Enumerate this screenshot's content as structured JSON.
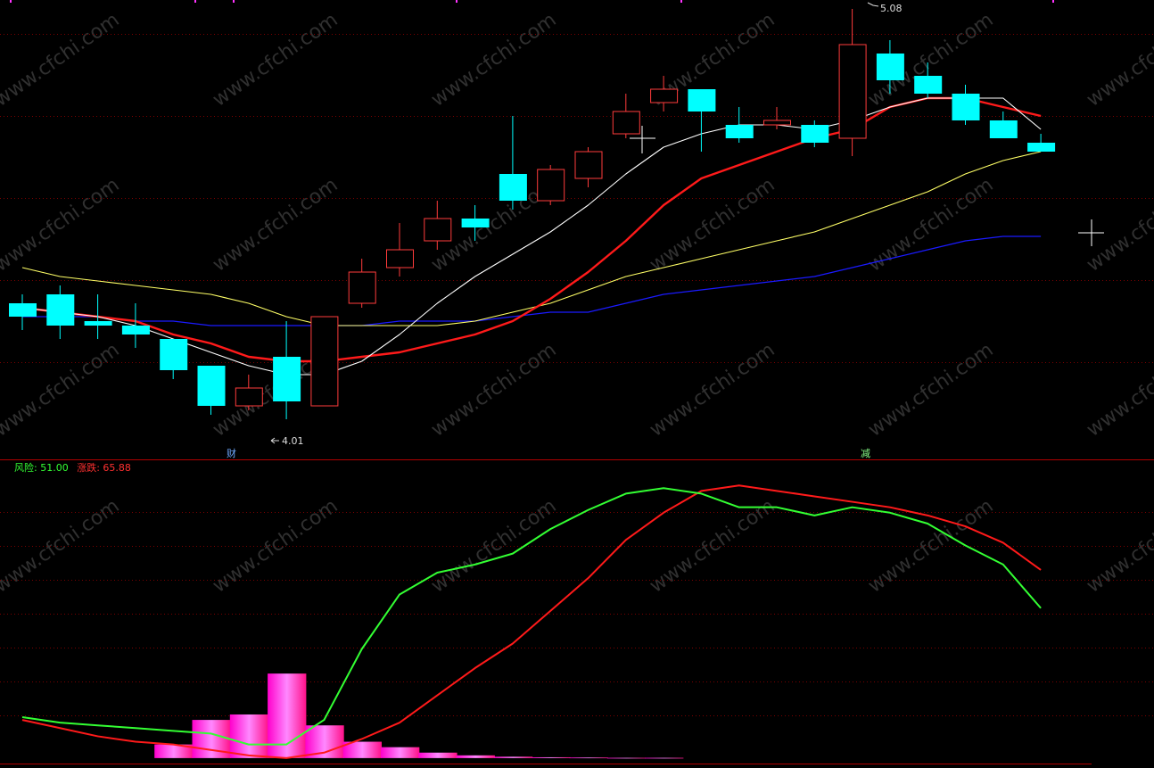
{
  "watermark": "www.cfchi.com",
  "price_panel": {
    "high_label": "5.08",
    "low_label": "4.01",
    "marker_cai": "财",
    "marker_jian": "减"
  },
  "indicator_panel": {
    "risk_label": "风险",
    "risk_value": "51.00",
    "change_label": "涨跌",
    "change_value": "65.88"
  },
  "colors": {
    "background": "#000000",
    "up": "#ff3b3b",
    "down": "#00ffff",
    "ma_white": "#ffffff",
    "ma_red": "#ff1a1a",
    "ma_yellow": "#ffff66",
    "ma_blue": "#1a1aff",
    "risk_line": "#33ff33",
    "change_line": "#ff1a1a",
    "histogram": "#ff33ff",
    "grid": "#7a0000"
  },
  "chart_data": [
    {
      "type": "candlestick",
      "candles": [
        {
          "o": 4.58,
          "c": 4.55,
          "h": 4.6,
          "l": 4.52
        },
        {
          "o": 4.6,
          "c": 4.53,
          "h": 4.62,
          "l": 4.5
        },
        {
          "o": 4.54,
          "c": 4.53,
          "h": 4.6,
          "l": 4.5
        },
        {
          "o": 4.53,
          "c": 4.51,
          "h": 4.58,
          "l": 4.48
        },
        {
          "o": 4.5,
          "c": 4.43,
          "h": 4.5,
          "l": 4.41
        },
        {
          "o": 4.44,
          "c": 4.35,
          "h": 4.44,
          "l": 4.33
        },
        {
          "o": 4.35,
          "c": 4.39,
          "h": 4.42,
          "l": 4.34
        },
        {
          "o": 4.46,
          "c": 4.36,
          "h": 4.54,
          "l": 4.32
        },
        {
          "o": 4.35,
          "c": 4.55,
          "h": 4.55,
          "l": 4.35
        },
        {
          "o": 4.58,
          "c": 4.65,
          "h": 4.68,
          "l": 4.57
        },
        {
          "o": 4.66,
          "c": 4.7,
          "h": 4.76,
          "l": 4.64
        },
        {
          "o": 4.72,
          "c": 4.77,
          "h": 4.81,
          "l": 4.7
        },
        {
          "o": 4.77,
          "c": 4.75,
          "h": 4.8,
          "l": 4.72
        },
        {
          "o": 4.87,
          "c": 4.81,
          "h": 5.0,
          "l": 4.79
        },
        {
          "o": 4.81,
          "c": 4.88,
          "h": 4.89,
          "l": 4.8
        },
        {
          "o": 4.86,
          "c": 4.92,
          "h": 4.93,
          "l": 4.84
        },
        {
          "o": 4.96,
          "c": 5.01,
          "h": 5.05,
          "l": 4.95
        },
        {
          "o": 5.03,
          "c": 5.06,
          "h": 5.09,
          "l": 5.01
        },
        {
          "o": 5.06,
          "c": 5.01,
          "h": 5.06,
          "l": 4.92
        },
        {
          "o": 4.98,
          "c": 4.95,
          "h": 5.02,
          "l": 4.94
        },
        {
          "o": 4.98,
          "c": 4.99,
          "h": 5.02,
          "l": 4.97
        },
        {
          "o": 4.98,
          "c": 4.94,
          "h": 4.99,
          "l": 4.93
        },
        {
          "o": 4.95,
          "c": 5.16,
          "h": 5.24,
          "l": 4.91
        },
        {
          "o": 5.14,
          "c": 5.08,
          "h": 5.17,
          "l": 5.05
        },
        {
          "o": 5.09,
          "c": 5.05,
          "h": 5.12,
          "l": 5.04
        },
        {
          "o": 5.05,
          "c": 4.99,
          "h": 5.07,
          "l": 4.98
        },
        {
          "o": 4.99,
          "c": 4.95,
          "h": 5.01,
          "l": 4.95
        },
        {
          "o": 4.94,
          "c": 4.92,
          "h": 4.96,
          "l": 4.92
        }
      ],
      "ma_white": [
        4.57,
        4.56,
        4.55,
        4.53,
        4.5,
        4.47,
        4.44,
        4.42,
        4.42,
        4.45,
        4.51,
        4.58,
        4.64,
        4.69,
        4.74,
        4.8,
        4.87,
        4.93,
        4.96,
        4.98,
        4.98,
        4.97,
        4.99,
        5.02,
        5.04,
        5.04,
        5.04,
        4.97
      ],
      "ma_red": [
        4.57,
        4.56,
        4.55,
        4.54,
        4.51,
        4.49,
        4.46,
        4.45,
        4.45,
        4.46,
        4.47,
        4.49,
        4.51,
        4.54,
        4.59,
        4.65,
        4.72,
        4.8,
        4.86,
        4.89,
        4.92,
        4.95,
        4.97,
        5.02,
        5.04,
        5.04,
        5.02,
        5.0
      ],
      "ma_yellow": [
        4.66,
        4.64,
        4.63,
        4.62,
        4.61,
        4.6,
        4.58,
        4.55,
        4.53,
        4.53,
        4.53,
        4.53,
        4.54,
        4.56,
        4.58,
        4.61,
        4.64,
        4.66,
        4.68,
        4.7,
        4.72,
        4.74,
        4.77,
        4.8,
        4.83,
        4.87,
        4.9,
        4.92
      ],
      "ma_blue": [
        4.55,
        4.55,
        4.55,
        4.54,
        4.54,
        4.53,
        4.53,
        4.53,
        4.53,
        4.53,
        4.54,
        4.54,
        4.54,
        4.55,
        4.56,
        4.56,
        4.58,
        4.6,
        4.61,
        4.62,
        4.63,
        4.64,
        4.66,
        4.68,
        4.7,
        4.72,
        4.73,
        4.73
      ],
      "ylim": [
        4.28,
        5.25
      ]
    },
    {
      "type": "line",
      "x": [
        0,
        1,
        2,
        3,
        4,
        5,
        6,
        7,
        8,
        9,
        10,
        11,
        12,
        13,
        14,
        15,
        16,
        17,
        18,
        19,
        20,
        21,
        22,
        23,
        24,
        25,
        26,
        27
      ],
      "series": [
        {
          "name": "风险",
          "values": [
            15,
            13,
            12,
            11,
            10,
            9,
            5,
            5,
            14,
            40,
            60,
            68,
            71,
            75,
            84,
            91,
            97,
            99,
            97,
            92,
            92,
            89,
            92,
            90,
            86,
            78,
            71,
            55
          ]
        },
        {
          "name": "涨跌",
          "values": [
            14,
            11,
            8,
            6,
            5,
            3,
            1,
            0,
            2,
            7,
            13,
            23,
            33,
            42,
            54,
            66,
            80,
            90,
            98,
            100,
            98,
            96,
            94,
            92,
            89,
            85,
            79,
            69
          ]
        }
      ],
      "histogram": [
        0,
        0,
        0,
        0,
        5,
        14,
        16,
        31,
        12,
        6,
        4,
        2,
        1,
        0.5,
        0.3,
        0.2,
        0.1,
        0.1,
        0,
        0,
        0,
        0,
        0,
        0,
        0,
        0,
        0,
        0
      ],
      "ylim": [
        -2,
        104
      ]
    }
  ]
}
